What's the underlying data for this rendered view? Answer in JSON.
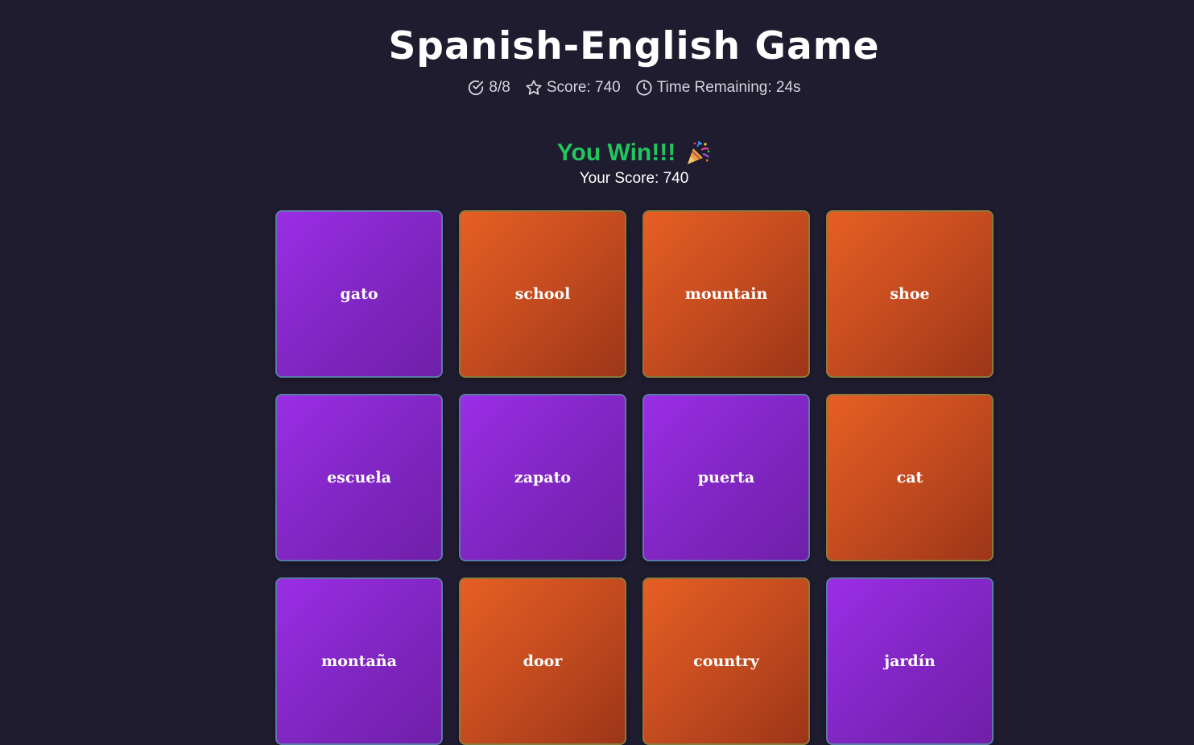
{
  "header": {
    "title": "Spanish-English Game",
    "matches": "8/8",
    "score_text": "Score: 740",
    "time_text": "Time Remaining: 24s"
  },
  "result": {
    "win_text": "You Win!!!",
    "score_text": "Your Score: 740"
  },
  "cards": [
    {
      "word": "gato",
      "lang": "spanish"
    },
    {
      "word": "school",
      "lang": "english"
    },
    {
      "word": "mountain",
      "lang": "english"
    },
    {
      "word": "shoe",
      "lang": "english"
    },
    {
      "word": "escuela",
      "lang": "spanish"
    },
    {
      "word": "zapato",
      "lang": "spanish"
    },
    {
      "word": "puerta",
      "lang": "spanish"
    },
    {
      "word": "cat",
      "lang": "english"
    },
    {
      "word": "montaña",
      "lang": "spanish"
    },
    {
      "word": "door",
      "lang": "english"
    },
    {
      "word": "country",
      "lang": "english"
    },
    {
      "word": "jardín",
      "lang": "spanish"
    }
  ],
  "icons": {
    "matches": "check-circle-icon",
    "score": "star-icon",
    "time": "clock-icon",
    "celebration": "party-popper-icon"
  },
  "colors": {
    "background": "#201c30",
    "win": "#22c55e",
    "spanish_card": "#8226c4",
    "english_card": "#c44b1f"
  }
}
